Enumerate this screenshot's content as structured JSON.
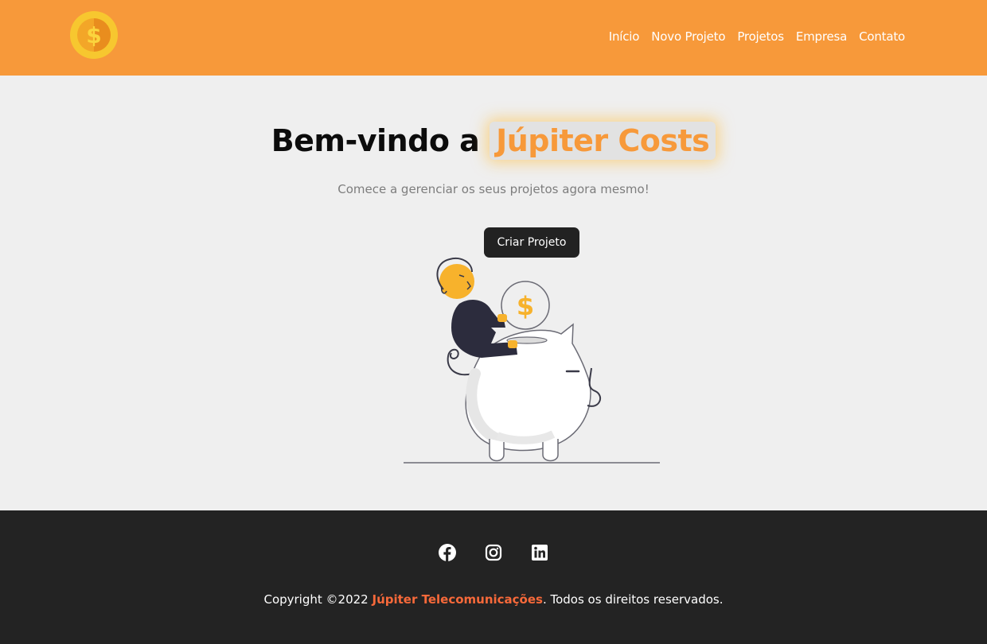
{
  "nav": {
    "logo_symbol": "$",
    "items": [
      {
        "label": "Início"
      },
      {
        "label": "Novo Projeto"
      },
      {
        "label": "Projetos"
      },
      {
        "label": "Empresa"
      },
      {
        "label": "Contato"
      }
    ]
  },
  "hero": {
    "title_prefix": "Bem-vindo a ",
    "title_brand": "Júpiter Costs",
    "subtitle": "Comece a gerenciar os seus projetos agora mesmo!",
    "cta_label": "Criar Projeto",
    "illustration_coin_symbol": "$"
  },
  "footer": {
    "social": [
      {
        "icon": "facebook-icon"
      },
      {
        "icon": "instagram-icon"
      },
      {
        "icon": "linkedin-icon"
      }
    ],
    "copyright_prefix": "Copyright ©2022 ",
    "company": "Júpiter Telecomunicações",
    "copyright_suffix": ". Todos os direitos reservados."
  },
  "colors": {
    "primary": "#f7993a",
    "dark": "#222222",
    "background": "#efefef",
    "company": "#f7693a"
  }
}
